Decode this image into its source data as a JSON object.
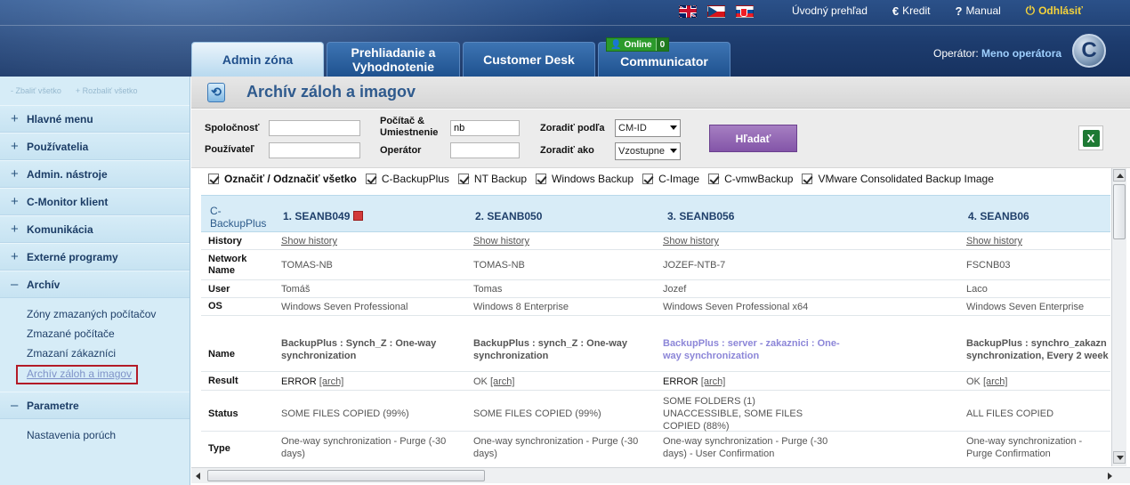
{
  "header": {
    "links": [
      "Úvodný prehľad",
      "Kredit",
      "Manual",
      "Odhlásiť"
    ],
    "tabs": [
      "Admin zóna",
      "Prehliadanie a Vyhodnotenie",
      "Customer Desk",
      "Communicator"
    ],
    "online_label": "Online",
    "online_count": "0",
    "operator_label": "Operátor:",
    "operator_name": "Meno operátora",
    "logo_letter": "C"
  },
  "sidebar": {
    "collapse_all": "- Zbaliť všetko",
    "expand_all": "+ Rozbaliť všetko",
    "items": [
      "Hlavné menu",
      "Používatelia",
      "Admin. nástroje",
      "C-Monitor klient",
      "Komunikácia",
      "Externé programy",
      "Archív"
    ],
    "archiv_links": [
      "Zóny zmazaných počítačov",
      "Zmazané počítače",
      "Zmazaní zákazníci",
      "Archív záloh a imagov"
    ],
    "parametre": "Parametre",
    "parametre_links": [
      "Nastavenia porúch"
    ]
  },
  "main": {
    "title": "Archív záloh a imagov",
    "filters": {
      "company_label": "Spoločnosť",
      "user_label": "Používateľ",
      "computer_label": "Počítač & Umiestnenie",
      "computer_value": "nb",
      "operator_label": "Operátor",
      "sort_by_label": "Zoradiť podľa",
      "sort_by_value": "CM-ID",
      "sort_as_label": "Zoradiť ako",
      "sort_as_value": "Vzostupne",
      "search_button": "Hľadať"
    },
    "checkboxes": [
      "Označiť / Odznačiť všetko",
      "C-BackupPlus",
      "NT Backup",
      "Windows Backup",
      "C-Image",
      "C-vmwBackup",
      "VMware Consolidated Backup Image"
    ],
    "category": "C-BackupPlus",
    "columns": [
      {
        "num": "1.",
        "name": "SEANB049"
      },
      {
        "num": "2.",
        "name": "SEANB050"
      },
      {
        "num": "3.",
        "name": "SEANB056"
      },
      {
        "num": "4.",
        "name": "SEANB06"
      }
    ],
    "rows": {
      "history": {
        "label": "History",
        "values": [
          "Show history",
          "Show history",
          "Show history",
          "Show history"
        ]
      },
      "network": {
        "label": "Network Name",
        "values": [
          "TOMAS-NB",
          "TOMAS-NB",
          "JOZEF-NTB-7",
          "FSCNB03"
        ]
      },
      "user": {
        "label": "User",
        "values": [
          "Tomáš",
          "Tomas",
          "Jozef",
          "Laco"
        ]
      },
      "os": {
        "label": "OS",
        "values": [
          "Windows Seven Professional",
          "Windows 8 Enterprise",
          "Windows Seven Professional x64",
          "Windows Seven Enterprise"
        ]
      },
      "name": {
        "label": "Name",
        "values": [
          "BackupPlus : Synch_Z : One-way synchronization",
          "BackupPlus : synch_Z : One-way synchronization",
          "BackupPlus : server - zakaznici : One-way synchronization",
          "BackupPlus : synchro_zakazn synchronization, Every 2 week"
        ]
      },
      "result": {
        "label": "Result",
        "values": [
          "ERROR",
          "OK",
          "ERROR",
          "OK"
        ],
        "arch": "[arch]"
      },
      "status": {
        "label": "Status",
        "values": [
          "SOME FILES COPIED (99%)",
          "SOME FILES COPIED (99%)",
          "SOME FOLDERS (1) UNACCESSIBLE, SOME FILES COPIED (88%)",
          "ALL FILES COPIED"
        ]
      },
      "type": {
        "label": "Type",
        "values": [
          "One-way synchronization - Purge (-30 days)",
          "One-way synchronization - Purge (-30 days)",
          "One-way synchronization - Purge (-30 days) - User Confirmation",
          "One-way synchronization - Purge Confirmation"
        ]
      }
    }
  }
}
